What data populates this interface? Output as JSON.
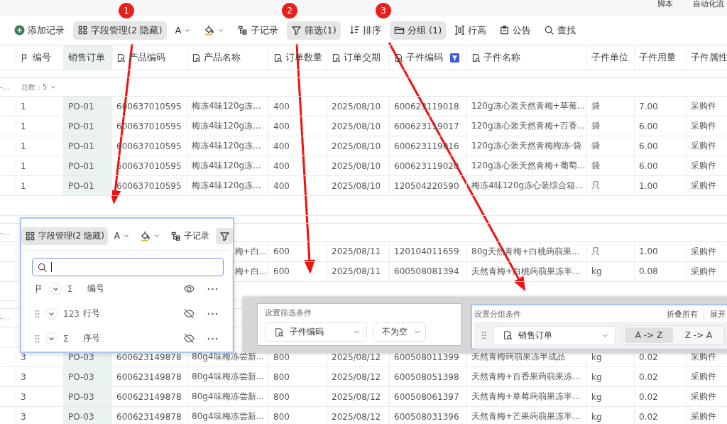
{
  "top_bar": {
    "items": [
      "脚本",
      "自动化流"
    ]
  },
  "toolbar": [
    {
      "kind": "add",
      "label": "添加记录",
      "selected": false
    },
    {
      "kind": "fields",
      "label": "字段管理(2 隐藏)",
      "selected": true
    },
    {
      "kind": "text_color",
      "glyph": "A",
      "selected": false
    },
    {
      "kind": "fill_color",
      "selected": false
    },
    {
      "kind": "subrecord",
      "label": "子记录",
      "selected": false
    },
    {
      "kind": "filter",
      "label": "筛选(1)",
      "selected": true
    },
    {
      "kind": "sort",
      "label": "排序",
      "selected": false
    },
    {
      "kind": "group",
      "label": "分组 (1)",
      "selected": true
    },
    {
      "kind": "row_height",
      "label": "行高",
      "selected": false
    },
    {
      "kind": "notice",
      "label": "公告",
      "selected": false
    },
    {
      "kind": "search",
      "label": "查找",
      "selected": false
    }
  ],
  "table": {
    "columns": [
      {
        "label": "编号",
        "kind": "primary",
        "grouped": false,
        "filtered": false
      },
      {
        "label": "销售订单",
        "kind": "plain",
        "grouped": true,
        "filtered": false
      },
      {
        "label": "产品编码",
        "kind": "lookup",
        "grouped": false,
        "filtered": false
      },
      {
        "label": "产品名称",
        "kind": "lookup",
        "grouped": false,
        "filtered": false
      },
      {
        "label": "订单数量",
        "kind": "lookup",
        "grouped": false,
        "filtered": false
      },
      {
        "label": "订单交期",
        "kind": "lookup",
        "grouped": false,
        "filtered": false
      },
      {
        "label": "子件编码",
        "kind": "lookup",
        "grouped": false,
        "filtered": true
      },
      {
        "label": "子件名称",
        "kind": "lookup",
        "grouped": false,
        "filtered": false
      },
      {
        "label": "子件单位",
        "kind": "plain",
        "grouped": false,
        "filtered": false
      },
      {
        "label": "子件用量",
        "kind": "plain",
        "grouped": false,
        "filtered": false
      },
      {
        "label": "子件属性",
        "kind": "plain",
        "grouped": false,
        "filtered": false
      }
    ],
    "groups": [
      {
        "label": "-...",
        "count": "总数：5",
        "rows": [
          [
            "1",
            "PO-01",
            "600637010595",
            "梅冻4味120g冻...",
            "400",
            "2025/08/10",
            "600623119018",
            "120g冻心装天然青梅+草莓...",
            "袋",
            "7.00",
            "采购件"
          ],
          [
            "1",
            "PO-01",
            "600637010595",
            "梅冻4味120g冻...",
            "400",
            "2025/08/10",
            "600623119017",
            "120g冻心装天然青梅+百香...",
            "袋",
            "6.00",
            "采购件"
          ],
          [
            "1",
            "PO-01",
            "600637010595",
            "梅冻4味120g冻...",
            "400",
            "2025/08/10",
            "600623119016",
            "120g冻心装天然青梅梅冻-袋",
            "袋",
            "6.00",
            "采购件"
          ],
          [
            "1",
            "PO-01",
            "600637010595",
            "梅冻4味120g冻...",
            "400",
            "2025/08/10",
            "600623119020",
            "120g冻心装天然青梅+葡萄...",
            "袋",
            "6.00",
            "采购件"
          ],
          [
            "1",
            "PO-01",
            "600637010595",
            "梅冻4味120g冻...",
            "400",
            "2025/08/10",
            "120504220590",
            "梅冻4味120g冻心装综合箱...",
            "只",
            "1.00",
            "采购件"
          ]
        ]
      },
      {
        "label": "-...",
        "rows": [
          [
            null,
            null,
            null,
            "梅+白...",
            "600",
            "2025/08/11",
            "120104011659",
            "80g天然青梅+白桃蒟蒻果...",
            "只",
            "1.00",
            "采购件"
          ],
          [
            null,
            null,
            null,
            "梅+白...",
            "600",
            "2025/08/11",
            "600508081394",
            "天然青梅+白桃蒟蒻果冻半...",
            "kg",
            "0.08",
            "采购件"
          ]
        ]
      },
      {
        "label": "-...",
        "rows": [
          [
            null,
            null,
            null,
            null,
            null,
            null,
            null,
            null,
            null,
            null,
            null
          ],
          [
            "3",
            "PO-03",
            "600623149878",
            "80g4味梅冻尝新...",
            "800",
            "2025/08/12",
            "600508011399",
            "天然青梅蒟蒻果冻半成品",
            "kg",
            "0.02",
            "采购件"
          ],
          [
            "3",
            "PO-03",
            "600623149878",
            "80g4味梅冻尝新...",
            "800",
            "2025/08/12",
            "600508051398",
            "天然青梅+百香果蒟蒻果冻...",
            "kg",
            "0.02",
            "采购件"
          ],
          [
            "3",
            "PO-03",
            "600623149878",
            "80g4味梅冻尝新...",
            "800",
            "2025/08/12",
            "600508061397",
            "天然青梅+草莓蒟蒻果冻半...",
            "kg",
            "0.02",
            "采购件"
          ],
          [
            "3",
            "PO-03",
            "600623149878",
            "80g4味梅冻尝新...",
            "800",
            "2025/08/12",
            "600508031396",
            "天然青梅+芒果蒟蒻果冻半...",
            "kg",
            "0.02",
            "采购件"
          ]
        ]
      }
    ]
  },
  "field_panel": {
    "toolbar": [
      {
        "kind": "fields",
        "label": "字段管理(2 隐藏)",
        "selected": true
      },
      {
        "kind": "text_color",
        "glyph": "A",
        "selected": false
      },
      {
        "kind": "fill_color",
        "selected": false
      },
      {
        "kind": "subrecord",
        "label": "子记录",
        "selected": false
      },
      {
        "kind": "filter",
        "selected": true
      }
    ],
    "search": {
      "focused": true
    },
    "fields": [
      {
        "kind": "primary",
        "type": "Σ",
        "name": "编号",
        "visible": true
      },
      {
        "kind": "normal",
        "type": "123",
        "name": "行号",
        "visible": false
      },
      {
        "kind": "normal",
        "type": "Σ",
        "name": "序号",
        "visible": false
      }
    ]
  },
  "filter_panel": {
    "title": "设置筛选条件",
    "field": "子件编码",
    "operator": "不为空"
  },
  "group_panel": {
    "title": "设置分组条件",
    "actions": [
      "折叠所有",
      "展开"
    ],
    "field": "销售订单",
    "orders": [
      {
        "label": "A -> Z",
        "selected": true
      },
      {
        "label": "Z -> A",
        "selected": false
      }
    ]
  },
  "annotations": [
    {
      "label": "1"
    },
    {
      "label": "2"
    },
    {
      "label": "3"
    }
  ]
}
